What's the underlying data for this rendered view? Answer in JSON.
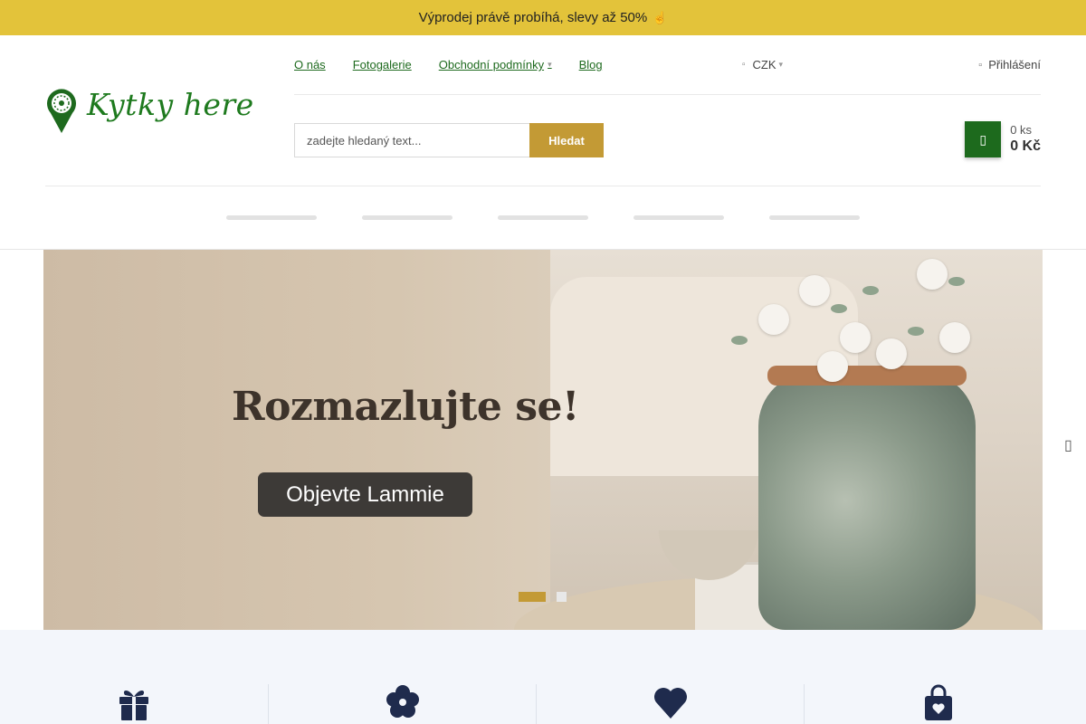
{
  "promo": {
    "text": "Výprodej právě probíhá, slevy až 50%",
    "icon": "pointing-hand-icon"
  },
  "logo": {
    "text": "Kytky here"
  },
  "top_nav": {
    "items": [
      {
        "label": "O nás"
      },
      {
        "label": "Fotogalerie"
      },
      {
        "label": "Obchodní podmínky"
      },
      {
        "label": "Blog"
      }
    ]
  },
  "currency": {
    "value": "CZK"
  },
  "login": {
    "label": "Přihlášení"
  },
  "search": {
    "placeholder": "zadejte hledaný text...",
    "button_label": "Hledat"
  },
  "cart": {
    "count": "0 ks",
    "total": "0 Kč"
  },
  "hero": {
    "title": "Rozmazlujte se!",
    "button_label": "Objevte Lammie",
    "slides_total": 2,
    "active_slide": 1
  },
  "benefits": {
    "icons": [
      "gift-icon",
      "flower-icon",
      "heart-icon",
      "shopping-bag-heart-icon"
    ]
  },
  "colors": {
    "promo_bg": "#e3c33a",
    "accent_gold": "#c39a35",
    "brand_green": "#1d6a1d",
    "benefits_bg": "#f3f6fb"
  }
}
